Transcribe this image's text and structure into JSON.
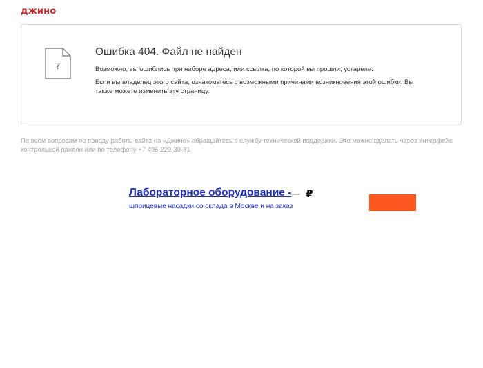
{
  "header": {
    "logo": "джино"
  },
  "error": {
    "icon": "file-question-icon",
    "icon_glyph": "?",
    "title": "Ошибка 404. Файл не найден",
    "message": "Возможно, вы ошиблись при наборе адреса, или ссылка, по которой вы прошли, устарела.",
    "owner_text_1": "Если вы владелец этого сайта, ознакомьтесь с",
    "reasons_link": "возможными причинами",
    "owner_text_2": "возникновения этой ошибки. Вы также можете",
    "edit_link": "изменить эту страницу",
    "owner_text_end": "."
  },
  "support": {
    "text": "По всем вопросам по поводу работы сайта на «Джино» обращайтесь в службу технической поддержки. Это можно сделать через интерфейс контрольной панели или по телефону +7 495 229-30-31."
  },
  "ad": {
    "title": "Лабораторное оборудование -",
    "price_dash": "—",
    "currency": "₽",
    "description": "шприцевые насадки со склада в Москве и на заказ",
    "button_color": "#ff5722"
  },
  "colors": {
    "brand": "#c62a2a",
    "ad_link": "#1f2fbf",
    "muted_text": "#a3a3a3",
    "card_border": "#d7d7d7"
  }
}
